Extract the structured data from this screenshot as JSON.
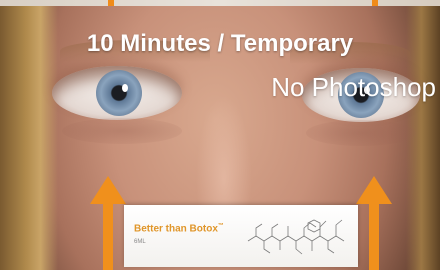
{
  "overlay": {
    "headline": "10 Minutes / Temporary",
    "subline": "No Photoshop"
  },
  "product": {
    "name": "Better than Botox",
    "trademark": "™",
    "volume": "6ML"
  },
  "icons": [
    "up-arrow-icon",
    "up-arrow-icon",
    "molecule-diagram-icon"
  ],
  "colors": {
    "arrow": "#f0901c",
    "overlay_text": "#ffffff",
    "brand": "#e0962a"
  }
}
